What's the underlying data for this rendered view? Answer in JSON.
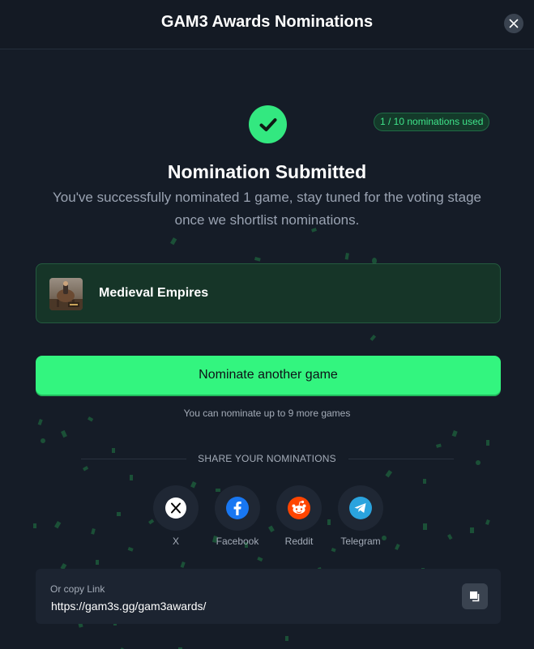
{
  "header": {
    "title": "GAM3 Awards Nominations"
  },
  "badge": {
    "text": "1 / 10 nominations used"
  },
  "status": {
    "title": "Nomination Submitted",
    "message": "You've successfully nominated 1 game, stay tuned for the voting stage once we shortlist nominations."
  },
  "game": {
    "name": "Medieval Empires"
  },
  "actions": {
    "nominate_label": "Nominate another game",
    "remaining_text": "You can nominate up to 9 more games"
  },
  "share": {
    "heading": "SHARE YOUR NOMINATIONS",
    "items": [
      {
        "label": "X",
        "icon": "x-icon"
      },
      {
        "label": "Facebook",
        "icon": "facebook-icon"
      },
      {
        "label": "Reddit",
        "icon": "reddit-icon"
      },
      {
        "label": "Telegram",
        "icon": "telegram-icon"
      }
    ]
  },
  "copy_link": {
    "caption": "Or copy Link",
    "url": "https://gam3s.gg/gam3awards/"
  },
  "colors": {
    "accent": "#33f57f",
    "background": "#151c27",
    "card": "#163528"
  }
}
